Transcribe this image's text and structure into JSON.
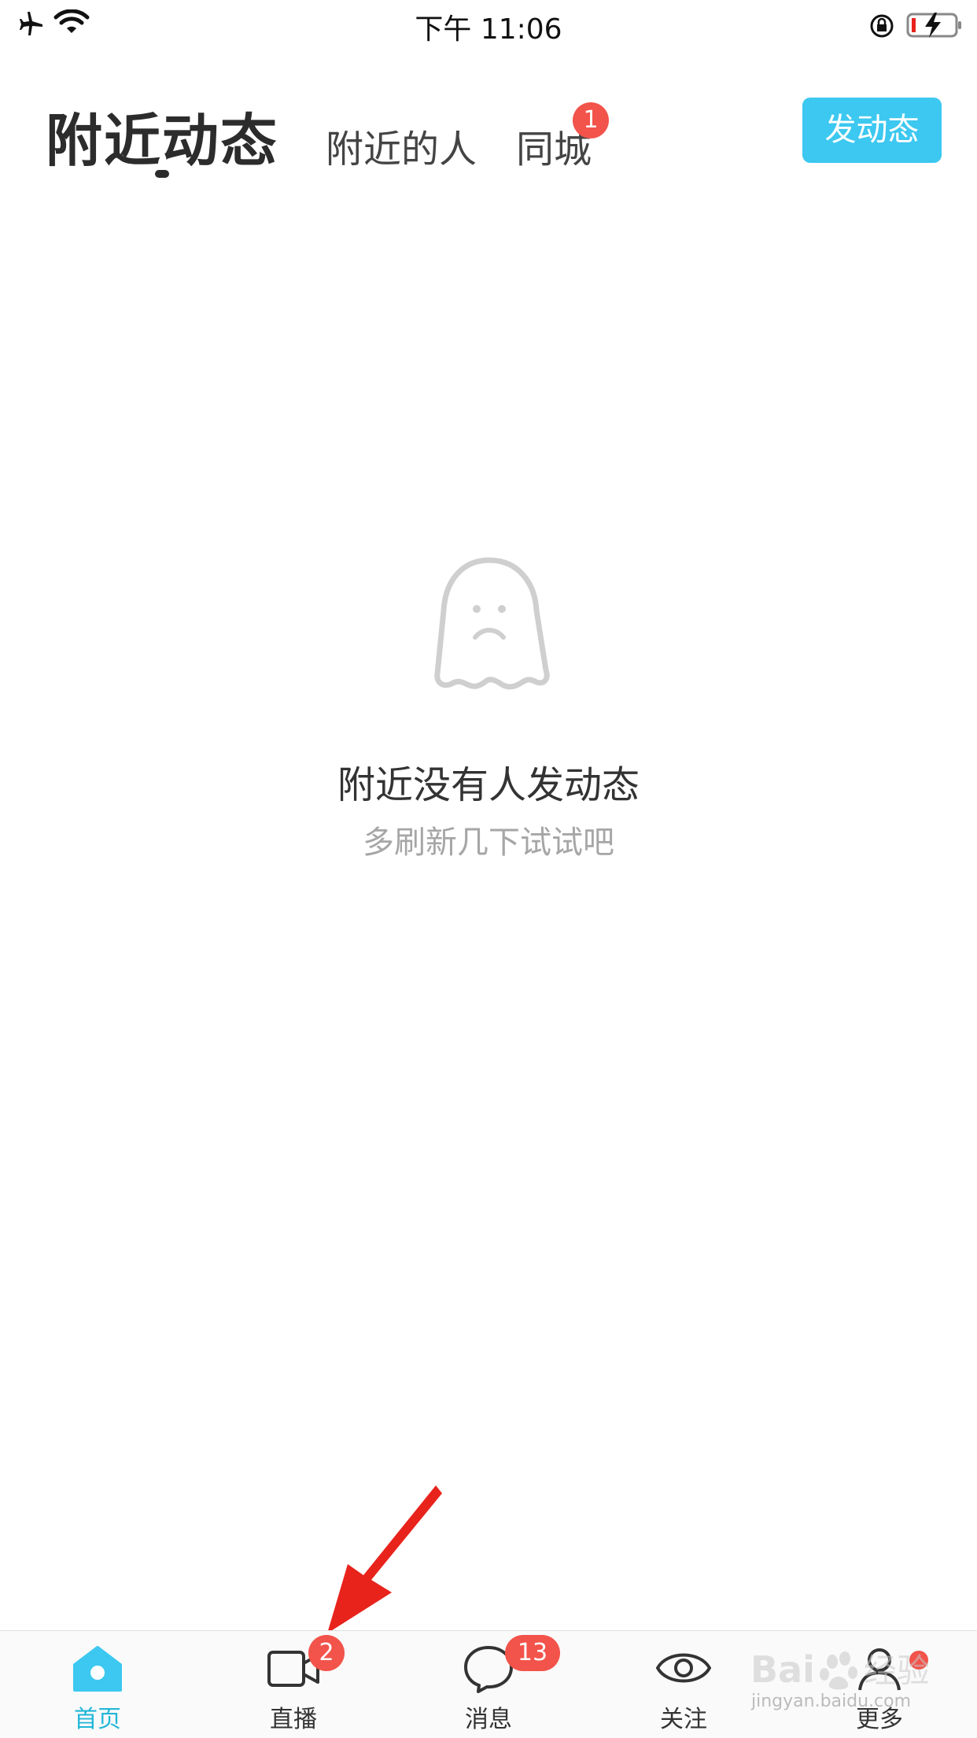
{
  "status_bar": {
    "time": "下午 11:06",
    "icons": [
      "airplane-icon",
      "wifi-icon",
      "rotation-lock-icon",
      "battery-charging-icon"
    ]
  },
  "header": {
    "tabs": [
      {
        "label": "附近动态",
        "active": true
      },
      {
        "label": "附近的人",
        "active": false
      },
      {
        "label": "同城",
        "active": false,
        "badge": "1"
      }
    ],
    "post_button": "发动态"
  },
  "empty_state": {
    "icon": "sad-ghost-icon",
    "title": "附近没有人发动态",
    "subtitle": "多刷新几下试试吧"
  },
  "bottom_nav": {
    "items": [
      {
        "label": "首页",
        "icon": "home-icon",
        "active": true
      },
      {
        "label": "直播",
        "icon": "video-camera-icon",
        "badge": "2"
      },
      {
        "label": "消息",
        "icon": "chat-bubble-icon",
        "badge": "13"
      },
      {
        "label": "关注",
        "icon": "eye-icon"
      },
      {
        "label": "更多",
        "icon": "user-more-icon",
        "badge_dot": true
      }
    ]
  },
  "colors": {
    "accent": "#3cc8f0",
    "badge": "#f2534a",
    "active_nav": "#21b7d8",
    "annotation_arrow": "#e8231c"
  },
  "watermark": {
    "text": "Bai经验",
    "url_text": "jingyan.baidu.com"
  }
}
